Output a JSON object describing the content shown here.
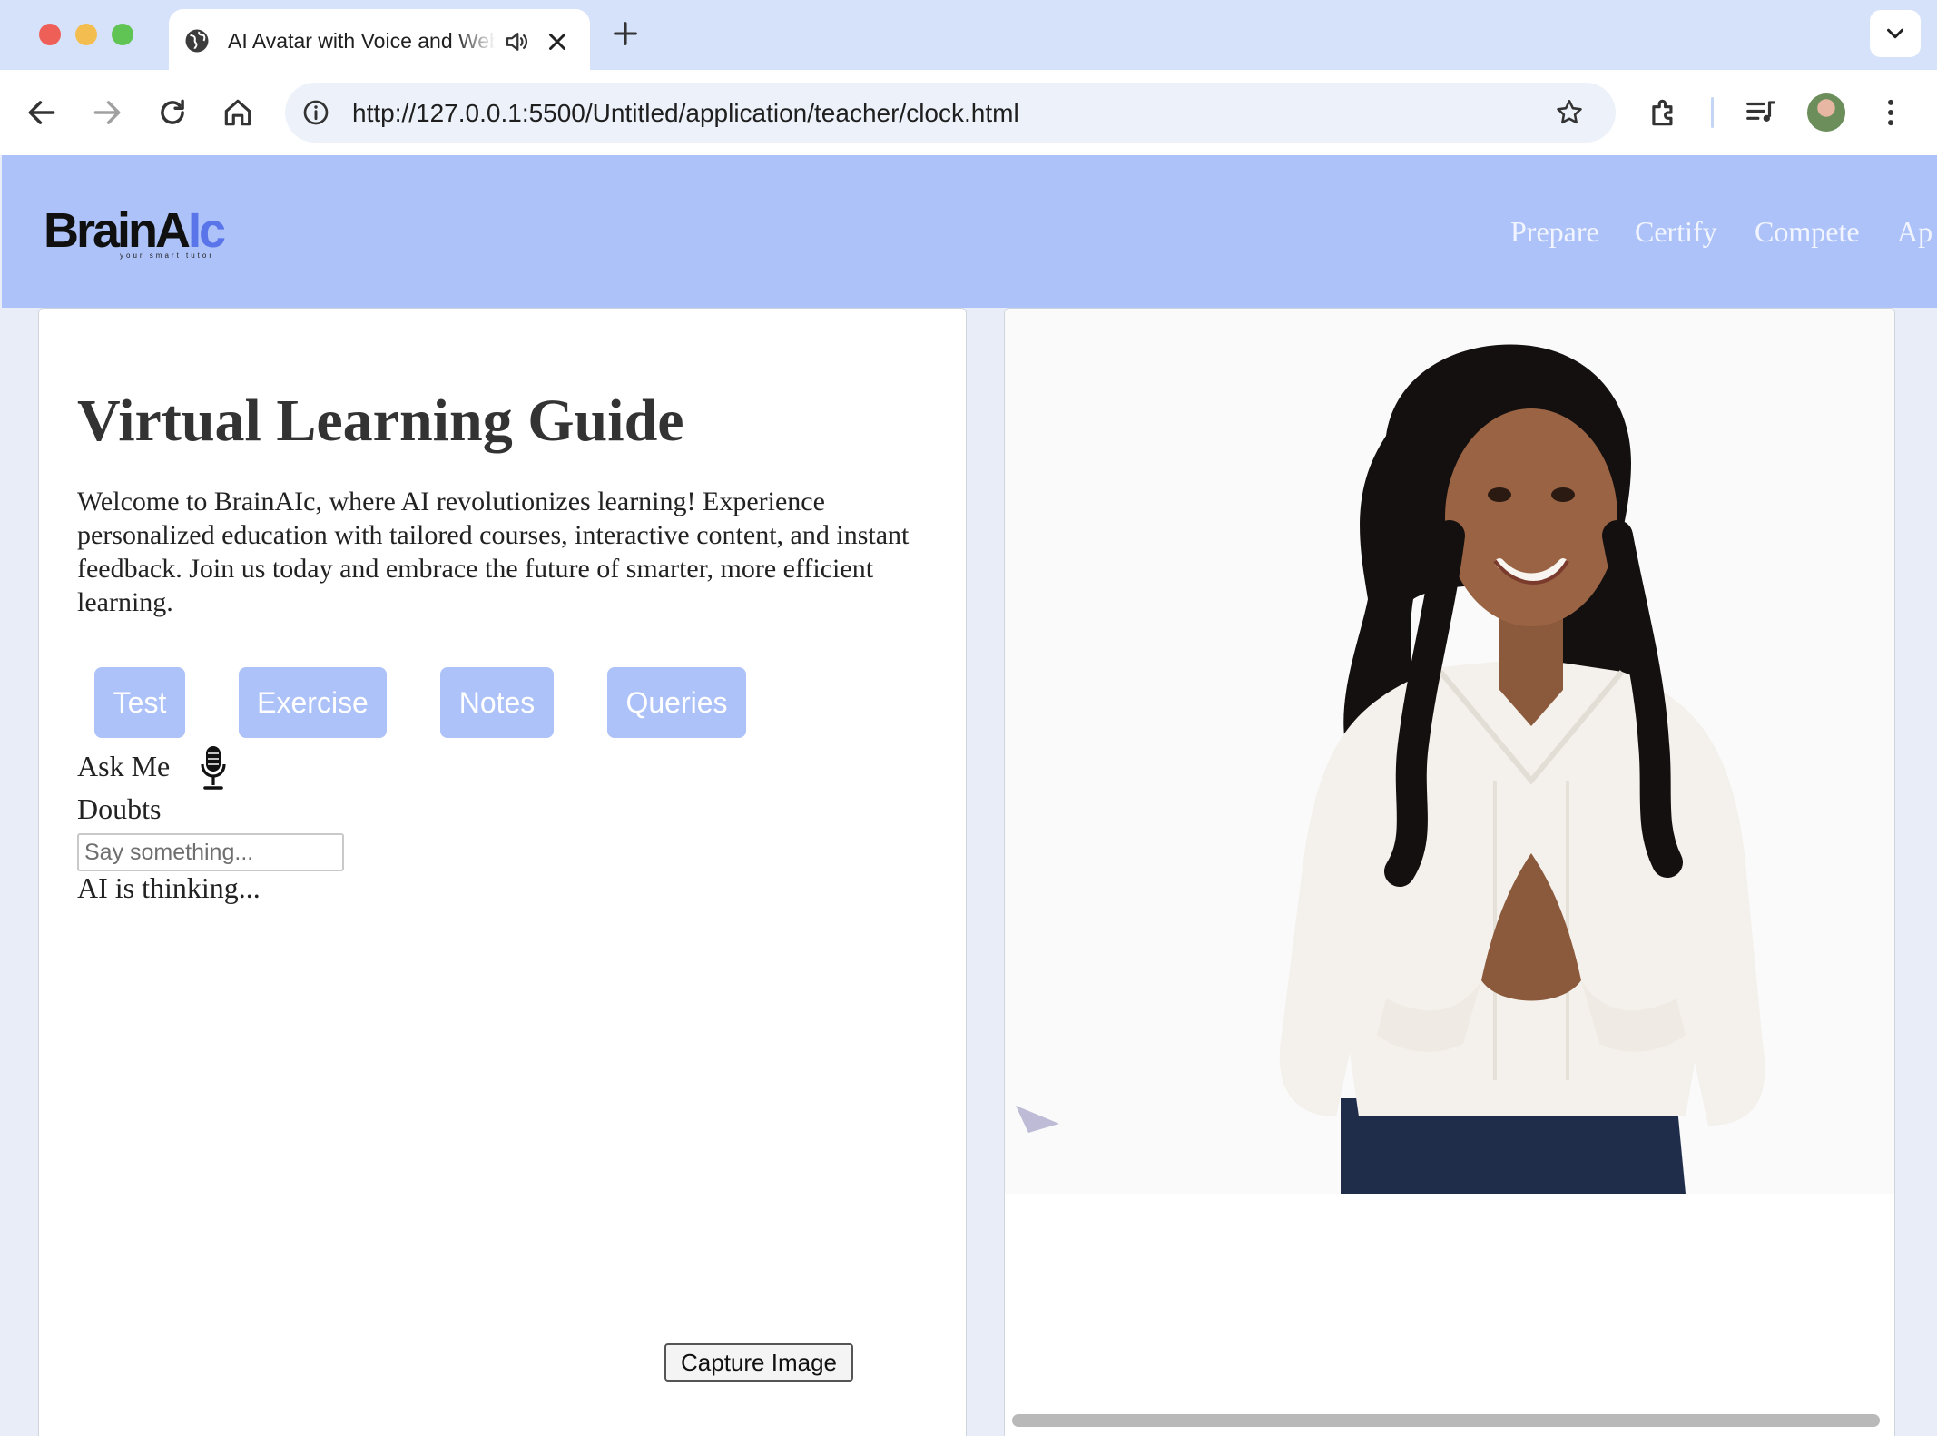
{
  "browser": {
    "tab_title": "AI Avatar with Voice and Web",
    "url": "http://127.0.0.1:5500/Untitled/application/teacher/clock.html"
  },
  "site": {
    "logo_main": "BrainA",
    "logo_accent": "Ic",
    "logo_tagline": "your smart tutor",
    "nav": [
      "Prepare",
      "Certify",
      "Compete",
      "Ap"
    ]
  },
  "guide": {
    "heading": "Virtual Learning Guide",
    "intro": "Welcome to BrainAIc, where AI revolutionizes learning! Experience personalized education with tailored courses, interactive content, and instant feedback. Join us today and embrace the future of smarter, more efficient learning.",
    "buttons": [
      "Test",
      "Exercise",
      "Notes",
      "Queries"
    ],
    "ask_label": "Ask Me",
    "doubts_label": "Doubts",
    "input_placeholder": "Say something...",
    "status": "AI is thinking...",
    "capture_label": "Capture Image"
  },
  "colors": {
    "header_bg": "#adc2f8",
    "button_bg": "#adc2f8",
    "logo_accent": "#5a74ea"
  }
}
